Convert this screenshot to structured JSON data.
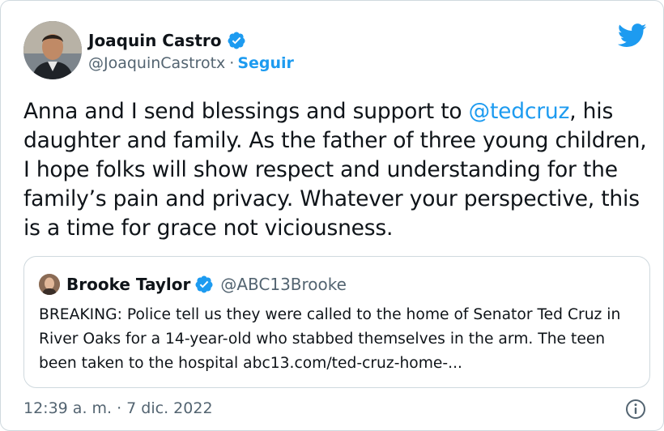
{
  "tweet": {
    "author_name": "Joaquin Castro",
    "handle": "@JoaquinCastrotx",
    "separator": "·",
    "follow_label": "Seguir",
    "text_before": "Anna and I send blessings and support to ",
    "mention": "@tedcruz",
    "text_after": ", his daughter and family. As the father of three young children, I hope folks will show respect and understanding for the family’s pain and privacy. Whatever your perspective, this is a time for grace not viciousness.",
    "timestamp": "12:39 a. m. · 7 dic. 2022"
  },
  "quote": {
    "author_name": "Brooke Taylor",
    "handle": "@ABC13Brooke",
    "text": "BREAKING: Police tell us they were called to the home of Senator Ted Cruz in River Oaks for a 14-year-old who stabbed themselves in the arm. The teen been taken to the hospital abc13.com/ted-cruz-home-..."
  },
  "colors": {
    "accent": "#1d9bf0",
    "text": "#0f1419",
    "secondary": "#536471",
    "border": "#cfd9de"
  },
  "icons": {
    "brand": "twitter-bird-icon",
    "verified": "verified-badge-icon",
    "info": "info-icon"
  }
}
